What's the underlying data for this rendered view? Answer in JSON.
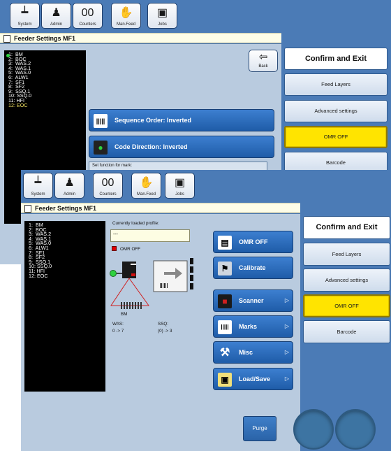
{
  "toolbar": {
    "buttons": [
      {
        "label": "System",
        "icon": "system-icon",
        "glyph": "┷"
      },
      {
        "label": "Admin",
        "icon": "admin-icon",
        "glyph": "♟"
      },
      {
        "label": "Counters",
        "icon": "counters-icon",
        "glyph": "00"
      },
      {
        "label": "Man.Feed",
        "icon": "hand-icon",
        "glyph": "✋"
      },
      {
        "label": "Jobs",
        "icon": "jobs-icon",
        "glyph": "▣"
      }
    ]
  },
  "back_window": {
    "title": "Feeder Settings MF1",
    "marks": [
      "1:  BM",
      "2:  BOC",
      "3:  WAS.2",
      "4:  WAS.1",
      "5:  WAS.0",
      "6:  ALW1",
      "7:  SF1",
      "8:  SF2",
      "9:  SSQ.1",
      "10: SSQ.0",
      "11: HFI",
      "12: EOC"
    ],
    "back_label": "Back",
    "sequence_order": "Sequence Order: Inverted",
    "code_direction": "Code Direction: Inverted",
    "set_function_label": "Set function for mark:",
    "right": {
      "confirm": "Confirm and Exit",
      "feed_layers": "Feed Layers",
      "advanced": "Advanced settings",
      "omr": "OMR OFF",
      "barcode": "Barcode"
    }
  },
  "front_window": {
    "title": "Feeder Settings MF1",
    "marks": [
      "1:  BM",
      "2:  BOC",
      "3:  WAS.2",
      "4:  WAS.1",
      "5:  WAS.0",
      "6:  ALW1",
      "7:  SF1",
      "8:  SF2",
      "9:  SSQ.1",
      "10: SSQ.0",
      "11: HFI",
      "12: EOC"
    ],
    "profile_label": "Currently loaded profile:",
    "profile_value": "---",
    "omr_status": "OMR OFF",
    "bm_label": "BM",
    "was_label": "WAS:",
    "was_value": "0 -> 7",
    "ssq_label": "SSQ:",
    "ssq_value": "(0) -> 3",
    "buttons": {
      "omr_off": "OMR OFF",
      "calibrate": "Calibrate",
      "scanner": "Scanner",
      "marks": "Marks",
      "misc": "Misc",
      "load_save": "Load/Save"
    },
    "purge": "Purge",
    "right": {
      "confirm": "Confirm and Exit",
      "feed_layers": "Feed Layers",
      "advanced": "Advanced settings",
      "omr": "OMR OFF",
      "barcode": "Barcode"
    }
  },
  "colors": {
    "frame_blue": "#4b7bb6",
    "content_blue": "#b9cbdf",
    "omr_yellow": "#ffe400",
    "button_blue": "#2a6ab8"
  }
}
